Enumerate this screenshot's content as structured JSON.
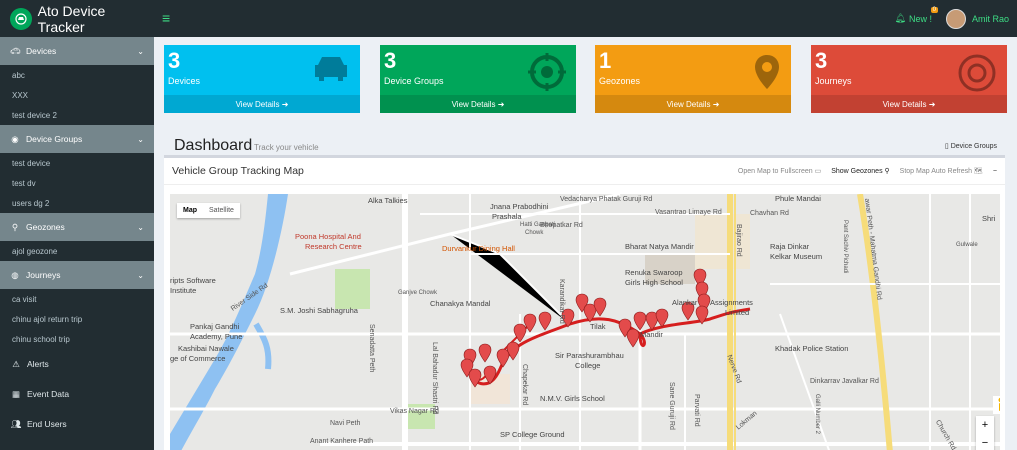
{
  "app": {
    "title": "Ato Device Tracker",
    "notif_label": "New !",
    "notif_count": "0",
    "user_name": "Amit Rao"
  },
  "sidebar": {
    "sections": [
      {
        "label": "Devices",
        "icon": "car-icon",
        "items": [
          "abc",
          "XXX",
          "test device 2"
        ]
      },
      {
        "label": "Device Groups",
        "icon": "target-icon",
        "items": [
          "test device",
          "test dv",
          "users dg 2"
        ]
      },
      {
        "label": "Geozones",
        "icon": "map-marker-icon",
        "items": [
          "ajol geozone"
        ]
      },
      {
        "label": "Journeys",
        "icon": "globe-icon",
        "items": [
          "ca visit",
          "chinu ajol return trip",
          "chinu school trip"
        ]
      }
    ],
    "main": [
      {
        "label": "Alerts",
        "icon": "warning-icon"
      },
      {
        "label": "Event Data",
        "icon": "table-icon"
      },
      {
        "label": "End Users",
        "icon": "users-icon"
      }
    ]
  },
  "stats": [
    {
      "count": "3",
      "label": "Devices",
      "link": "View Details",
      "color": "#00c0ef"
    },
    {
      "count": "3",
      "label": "Device Groups",
      "link": "View Details",
      "color": "#00a65a"
    },
    {
      "count": "1",
      "label": "Geozones",
      "link": "View Details",
      "color": "#f39c12"
    },
    {
      "count": "3",
      "label": "Journeys",
      "link": "View Details",
      "color": "#dd4b39"
    }
  ],
  "dashboard": {
    "title": "Dashboard",
    "subtitle": "Track your vehicle",
    "link": "Device Groups"
  },
  "panel": {
    "title": "Vehicle Group Tracking Map",
    "tool_fullscreen": "Open Map to Fullscreen",
    "tool_geozones": "Show Geozones",
    "tool_refresh": "Stop Map Auto Refresh"
  },
  "map": {
    "type_map": "Map",
    "type_satellite": "Satellite",
    "zoom_in": "+",
    "zoom_out": "−",
    "labels": {
      "alka": "Alka Talkies",
      "jnana": "Jnana Prabodhini",
      "prashala": "Prashala",
      "vedacharya": "Vedacharya Phatak Guruji Rd",
      "vasantrao": "Vasantrao Limaye Rd",
      "phule": "Phule Mandai",
      "chavhan": "Chavhan Rd",
      "bhopatkar": "Bhopatkar Rd",
      "poona1": "Poona Hospital And",
      "poona2": "Research Centre",
      "durvankur": "Durvankur Dining Hall",
      "bharat": "Bharat Natya Mandir",
      "raja1": "Raja Dinkar",
      "raja2": "Kelkar Museum",
      "renuka1": "Renuka Swaroop",
      "renuka2": "Girls High School",
      "scripts1": "ripts Software",
      "scripts2": "Institute",
      "ganjve": "Ganjve Chowk",
      "chanakya": "Chanakya Mandal",
      "alankar": "Alankar",
      "assign": "Assignments",
      "limited": "Limited",
      "joshi": "S.M. Joshi Sabhagruha",
      "riverside": "River Side Rd",
      "tilak": "Tilak",
      "mandir": "Mandir",
      "pankaj1": "Pankaj Gandhi",
      "pankaj2": "Academy, Pune",
      "kashibai1": "Kashibai Nawale",
      "kashibai2": "ge of Commerce",
      "sirparash1": "Sir Parashurambhau",
      "sirparash2": "College",
      "khadak": "Khadak Police Station",
      "dinkarrav": "Dinkarrav Javalkar Rd",
      "nmv": "N.M.V. Girls School",
      "vikas": "Vikas Nagar Rd",
      "navi": "Navi Peth",
      "spcollege": "SP College Ground",
      "anant": "Anant Kanhere Path",
      "hatti1": "Hatti Ganpati",
      "hatti2": "Chowk",
      "karandikar": "Karandikar Rd",
      "bajirao": "Bajirao Rd",
      "lbs": "Lal Bahadur Shastri Rd",
      "chapekar": "Chapekar Rd",
      "sadashiv": "Senadatta Peth",
      "saneguruji": "Sane Guruji Rd",
      "parvati": "Parvati Rd",
      "nerve": "Nerve Rd",
      "mahatma": "awar Peth - Mahatma Gandhi Rd",
      "pantsachiv": "Pant Sachiv Pichadi",
      "shri": "Shri",
      "gulwale": "Gulwale",
      "galli": "Galli Number 2",
      "church": "Church Rd",
      "lokman": "Lokman"
    }
  }
}
